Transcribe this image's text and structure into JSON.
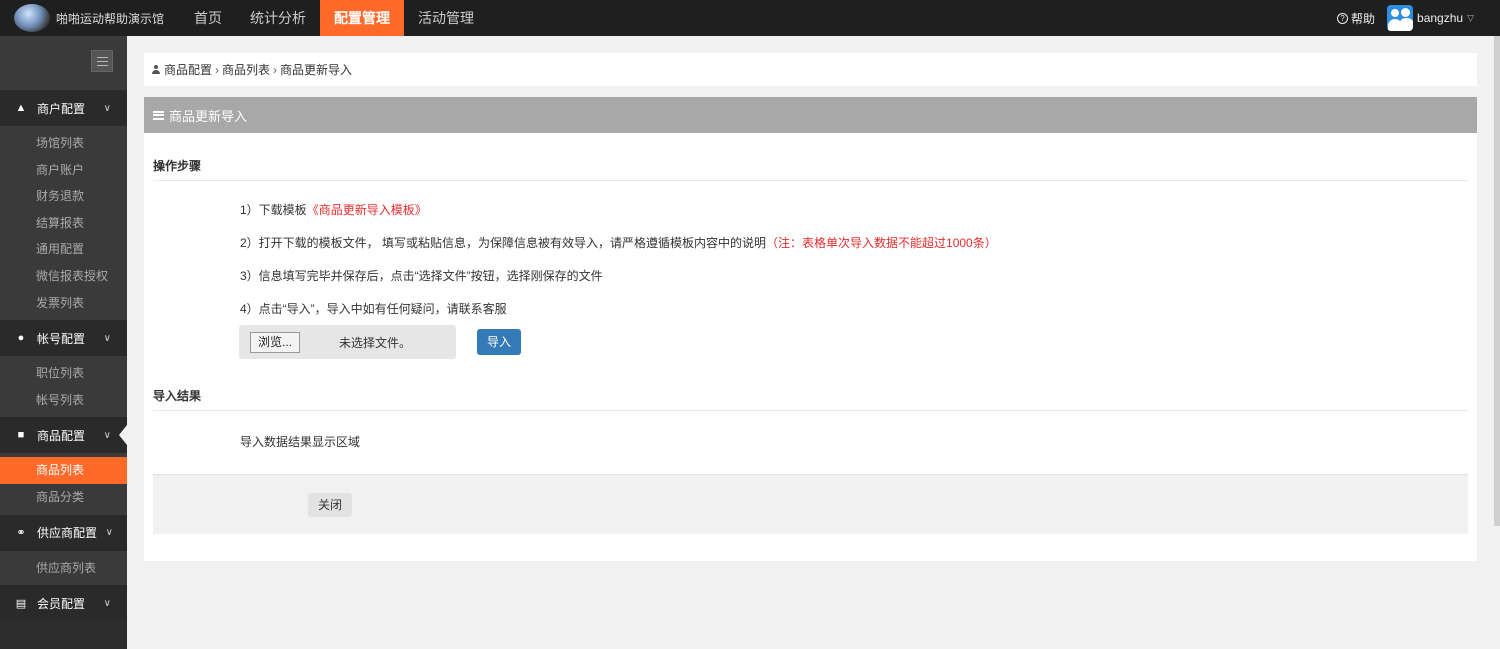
{
  "header": {
    "brand": "啪啪运动帮助演示馆",
    "nav": [
      {
        "label": "首页",
        "active": false
      },
      {
        "label": "统计分析",
        "active": false
      },
      {
        "label": "配置管理",
        "active": true
      },
      {
        "label": "活动管理",
        "active": false
      }
    ],
    "help_label": "帮助",
    "username": "bangzhu"
  },
  "sidebar": {
    "groups": [
      {
        "label": "商户配置",
        "icon": "home-icon",
        "items": [
          "场馆列表",
          "商户账户",
          "财务退款",
          "结算报表",
          "通用配置",
          "微信报表授权",
          "发票列表"
        ]
      },
      {
        "label": "帐号配置",
        "icon": "user-icon",
        "items": [
          "职位列表",
          "帐号列表"
        ]
      },
      {
        "label": "商品配置",
        "icon": "gift-icon",
        "items": [
          "商品列表",
          "商品分类"
        ],
        "active_item": "商品列表"
      },
      {
        "label": "供应商配置",
        "icon": "link-icon",
        "items": [
          "供应商列表"
        ]
      },
      {
        "label": "会员配置",
        "icon": "id-card-icon",
        "items": []
      }
    ]
  },
  "breadcrumb": [
    "商品配置",
    "商品列表",
    "商品更新导入"
  ],
  "panel": {
    "title": "商品更新导入",
    "steps_title": "操作步骤",
    "step1_prefix": "1）下载模板",
    "step1_link": "《商品更新导入模板》",
    "step2_text": "2）打开下载的模板文件， 填写或粘贴信息，为保障信息被有效导入，请严格遵循模板内容中的说明",
    "step2_note": "（注：表格单次导入数据不能超过1000条）",
    "step3_text": "3）信息填写完毕并保存后，点击“选择文件”按钮，选择刚保存的文件",
    "step4_text": "4）点击“导入”，导入中如有任何疑问，请联系客服",
    "browse_label": "浏览...",
    "file_status": "未选择文件。",
    "import_label": "导入",
    "result_title": "导入结果",
    "result_placeholder": "导入数据结果显示区域",
    "close_label": "关闭"
  },
  "colors": {
    "accent": "#ff6a2b",
    "primary_button": "#337ab7",
    "warning_text": "#e52d2d",
    "sidebar_bg": "#2d2d2d",
    "topbar_bg": "#1f1f1f"
  }
}
